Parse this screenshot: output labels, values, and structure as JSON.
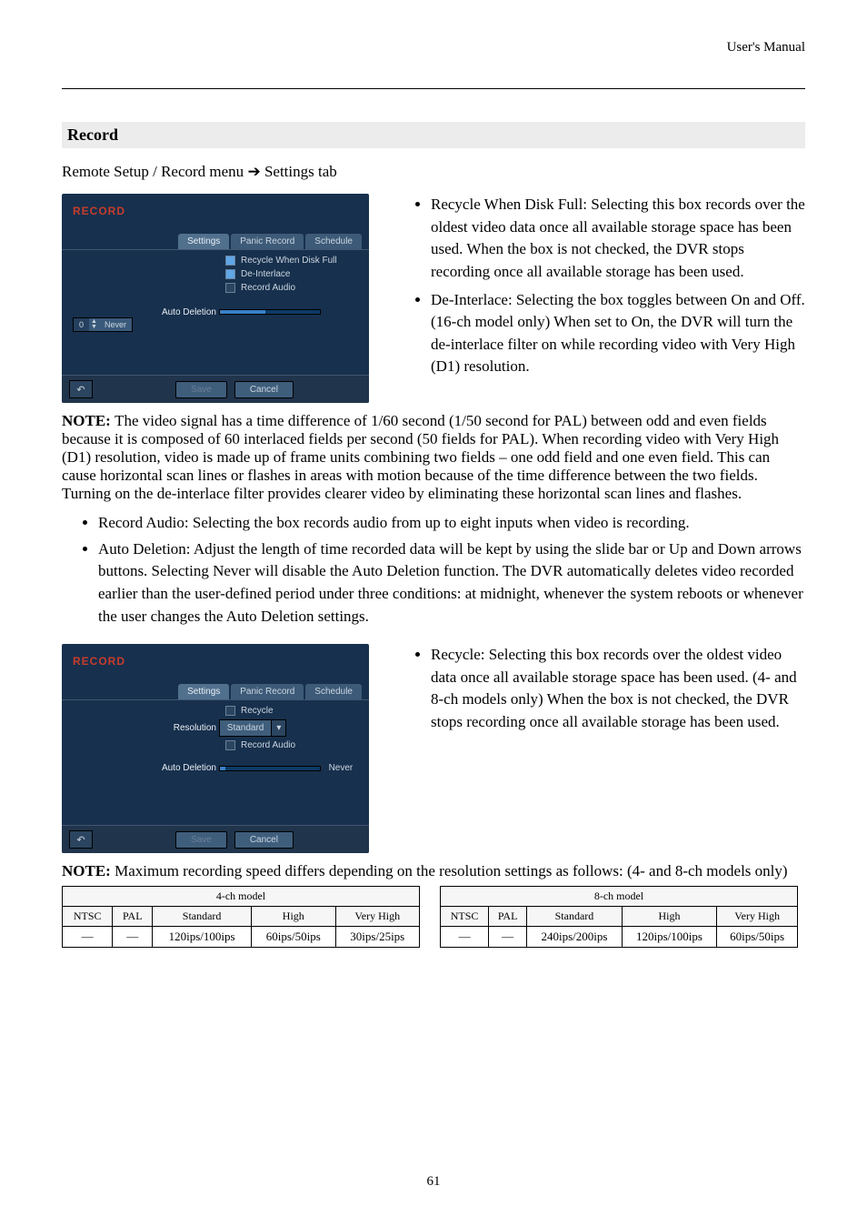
{
  "header": "User's Manual",
  "section_title": "Record",
  "nav": {
    "prefix": "Remote Setup / Record menu ",
    "arrow": "➔",
    "suffix": " Settings tab"
  },
  "shot1": {
    "title": "RECORD",
    "tabs": {
      "settings": "Settings",
      "panic": "Panic Record",
      "schedule": "Schedule"
    },
    "checks": {
      "recycle": "Recycle When Disk Full",
      "deinter": "De-Interlace",
      "audio": "Record Audio"
    },
    "row_label": "Auto Deletion",
    "spin_num": "0",
    "spin_lbl": "Never",
    "save": "Save",
    "cancel": "Cancel"
  },
  "right1": {
    "b1_label": "Recycle When Disk Full",
    "b1_text": ": Selecting this box records over the oldest video data once all available storage space has been used.  When the box is not checked, the DVR stops recording once all available storage has been used.",
    "b2_label": "De-Interlace",
    "b2_text_a": ": Selecting the box toggles between On and Off. (16-ch model only)  When set to ",
    "b2_on": "On",
    "b2_text_b": ", the DVR will turn the de-interlace filter on while recording video with Very High (D1) resolution."
  },
  "note_deinterlace": {
    "bold": "NOTE: ",
    "text": "The video signal has a time difference of 1/60 second (1/50 second for PAL) between odd and even fields because it is composed of 60 interlaced fields per second (50 fields for PAL).  When recording video with Very High (D1) resolution, video is made up of frame units combining two fields – one odd field and one even field.  This can cause horizontal scan lines or flashes in areas with motion because of the time difference between the two fields.  Turning on the de-interlace filter provides clearer video by eliminating these horizontal scan lines and flashes."
  },
  "wide": {
    "b1_label": "Record Audio",
    "b1_text": ": Selecting the box records audio from up to eight inputs when video is recording.",
    "b2_label": "Auto Deletion",
    "b2_text_a": ": Adjust the length of time recorded data will be kept by using the slide bar or Up and Down arrows buttons.  Selecting ",
    "b2_never": "Never",
    "b2_text_b": " will disable the Auto Deletion function.  The DVR automatically deletes video recorded earlier than the user-defined period under three conditions: at midnight, whenever the system reboots or whenever the user changes the Auto Deletion settings."
  },
  "shot2": {
    "title": "RECORD",
    "tabs": {
      "settings": "Settings",
      "panic": "Panic Record",
      "schedule": "Schedule"
    },
    "check": "Recycle",
    "res_label": "Resolution",
    "res_val": "Standard",
    "audio": "Record Audio",
    "row_label": "Auto Deletion",
    "never": "Never",
    "save": "Save",
    "cancel": "Cancel"
  },
  "right2": {
    "b1_label": "Recycle",
    "b1_text": ": Selecting this box records over the oldest video data once all available storage space has been used. (4- and 8-ch models only)  When the box is not checked, the DVR stops recording once all available storage has been used."
  },
  "tables_note": {
    "bold": "NOTE: ",
    "text": "Maximum recording speed differs depending on the resolution settings as follows: (4- and 8-ch models only)"
  },
  "tableA": {
    "caption": "4-ch model",
    "headers": [
      "",
      "Standard",
      "High",
      "Very High"
    ],
    "rowlabels": [
      "NTSC",
      "PAL"
    ],
    "data": [
      [
        "—",
        "120ips",
        "60ips",
        "30ips"
      ],
      [
        "—",
        "100ips",
        "50ips",
        "25ips"
      ]
    ]
  },
  "tableB": {
    "caption": "8-ch model",
    "headers": [
      "",
      "Standard",
      "High",
      "Very High"
    ],
    "rowlabels": [
      "NTSC",
      "PAL"
    ],
    "data": [
      [
        "—",
        "240ips",
        "120ips",
        "60ips"
      ],
      [
        "—",
        "200ips",
        "100ips",
        "50ips"
      ]
    ]
  },
  "page_number": "61"
}
